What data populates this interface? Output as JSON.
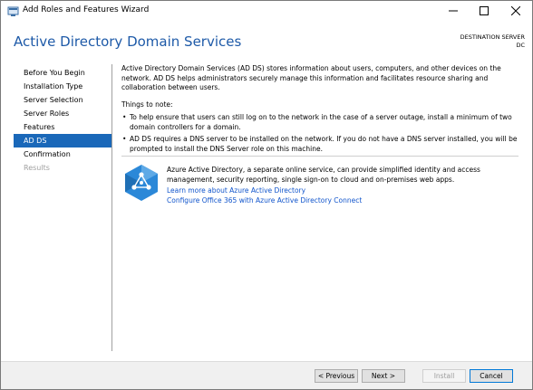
{
  "window": {
    "title": "Add Roles and Features Wizard",
    "controls": {
      "minimize": "minimize",
      "maximize": "maximize",
      "close": "close"
    }
  },
  "header": {
    "title": "Active Directory Domain Services",
    "destination_label": "DESTINATION SERVER",
    "destination_server": "DC"
  },
  "nav": {
    "items": [
      {
        "label": "Before You Begin",
        "state": "normal"
      },
      {
        "label": "Installation Type",
        "state": "normal"
      },
      {
        "label": "Server Selection",
        "state": "normal"
      },
      {
        "label": "Server Roles",
        "state": "normal"
      },
      {
        "label": "Features",
        "state": "normal"
      },
      {
        "label": "AD DS",
        "state": "active"
      },
      {
        "label": "Confirmation",
        "state": "normal"
      },
      {
        "label": "Results",
        "state": "disabled"
      }
    ]
  },
  "content": {
    "intro": "Active Directory Domain Services (AD DS) stores information about users, computers, and other devices on the network.  AD DS helps administrators securely manage this information and facilitates resource sharing and collaboration between users.",
    "things_to_note": "Things to note:",
    "notes": [
      "To help ensure that users can still log on to the network in the case of a server outage, install a minimum of two domain controllers for a domain.",
      "AD DS requires a DNS server to be installed on the network.  If you do not have a DNS server installed, you will be prompted to install the DNS Server role on this machine."
    ],
    "bullet": "•"
  },
  "azure": {
    "description": "Azure Active Directory, a separate online service, can provide simplified identity and access management, security reporting, single sign-on to cloud and on-premises web apps.",
    "link_learn": "Learn more about Azure Active Directory",
    "link_configure": "Configure Office 365 with Azure Active Directory Connect"
  },
  "footer": {
    "previous": "< Previous",
    "next": "Next >",
    "install": "Install",
    "cancel": "Cancel"
  },
  "colors": {
    "accent": "#1a68b9",
    "title": "#1e5aa8",
    "link": "#1155cc"
  }
}
